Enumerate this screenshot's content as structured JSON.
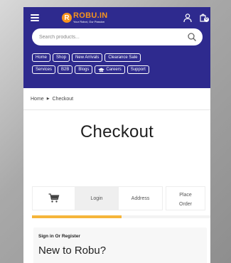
{
  "brand": {
    "logo_letter": "R",
    "name": "ROBU.IN",
    "tagline": "Your Robot, Our Passion",
    "accent_color": "#f7941d",
    "header_color": "#2e2a8e"
  },
  "icons": {
    "menu": "hamburger-menu-icon",
    "user": "user-icon",
    "cart": "cart-icon",
    "search": "search-icon",
    "cap": "graduation-cap-icon",
    "step_cart": "shopping-cart-icon"
  },
  "cart": {
    "count": "0"
  },
  "search": {
    "placeholder": "Search products..."
  },
  "nav": {
    "row1": [
      "Home",
      "Shop",
      "New Arrivals",
      "Clearance Sale"
    ],
    "row2": [
      "Services",
      "B2B",
      "Blogs",
      "Careers",
      "Support"
    ]
  },
  "breadcrumb": {
    "home": "Home",
    "separator": "▶",
    "current": "Checkout"
  },
  "page": {
    "title": "Checkout"
  },
  "steps": {
    "login": "Login",
    "address": "Address",
    "place_line1": "Place",
    "place_line2": "Order",
    "progress_fraction": 0.5
  },
  "signin": {
    "label": "Sign in Or Register",
    "heading": "New to Robu?"
  }
}
